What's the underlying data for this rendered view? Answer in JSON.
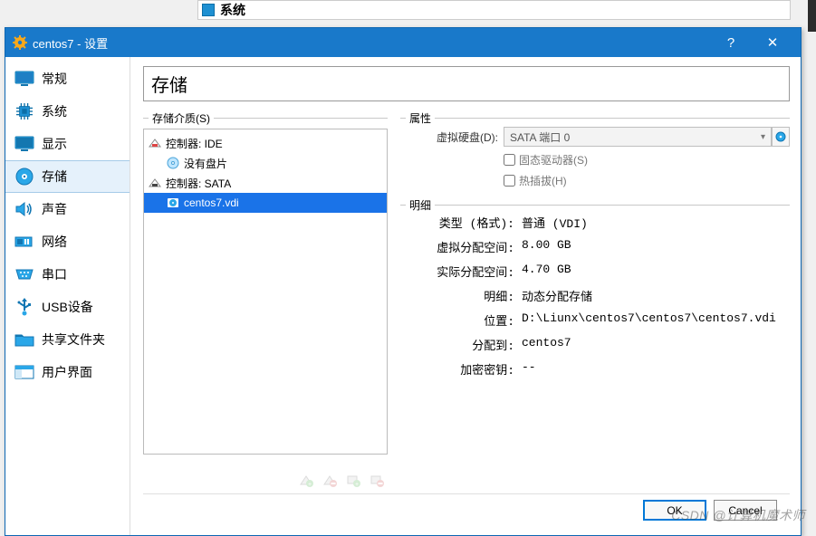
{
  "main_window": {
    "system_label": "系统"
  },
  "dialog": {
    "title": "centos7 - 设置",
    "help_btn": "?",
    "close_btn": "✕"
  },
  "categories": [
    {
      "id": "general",
      "label": "常规",
      "icon": "monitor"
    },
    {
      "id": "system",
      "label": "系统",
      "icon": "chip"
    },
    {
      "id": "display",
      "label": "显示",
      "icon": "monitor"
    },
    {
      "id": "storage",
      "label": "存储",
      "icon": "disk",
      "active": true
    },
    {
      "id": "audio",
      "label": "声音",
      "icon": "speaker"
    },
    {
      "id": "network",
      "label": "网络",
      "icon": "nic"
    },
    {
      "id": "serial",
      "label": "串口",
      "icon": "serial"
    },
    {
      "id": "usb",
      "label": "USB设备",
      "icon": "usb"
    },
    {
      "id": "shared",
      "label": "共享文件夹",
      "icon": "folder"
    },
    {
      "id": "ui",
      "label": "用户界面",
      "icon": "window"
    }
  ],
  "page": {
    "title": "存储",
    "media_legend": "存储介质(S)",
    "attrs_legend": "属性",
    "detail_legend": "明细"
  },
  "tree": {
    "ide_label": "控制器: IDE",
    "ide_child": "没有盘片",
    "sata_label": "控制器: SATA",
    "sata_child": "centos7.vdi"
  },
  "attrs": {
    "virtual_disk_label": "虚拟硬盘(D):",
    "virtual_disk_value": "SATA 端口 0",
    "ssd_label": "固态驱动器(S)",
    "hotplug_label": "热插拔(H)"
  },
  "detail": {
    "type_k": "类型 (格式):",
    "type_v": "普通  (VDI)",
    "vsize_k": "虚拟分配空间:",
    "vsize_v": "8.00  GB",
    "asize_k": "实际分配空间:",
    "asize_v": "4.70  GB",
    "detail_k": "明细:",
    "detail_v": "动态分配存储",
    "loc_k": "位置:",
    "loc_v": "D:\\Liunx\\centos7\\centos7\\centos7.vdi",
    "attach_k": "分配到:",
    "attach_v": "centos7",
    "enc_k": "加密密钥:",
    "enc_v": "--"
  },
  "footer": {
    "ok": "OK",
    "cancel": "Cancel"
  },
  "watermark": "CSDN @计算机魔术师"
}
